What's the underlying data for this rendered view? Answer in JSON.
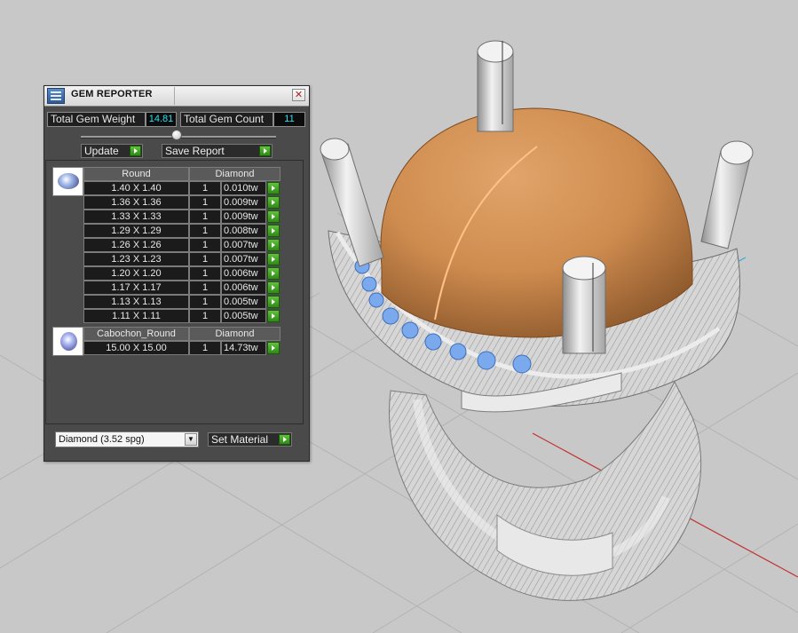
{
  "window": {
    "title": "GEM REPORTER",
    "close_glyph": "✕"
  },
  "stats": {
    "total_weight_label": "Total Gem Weight",
    "total_weight_value": "14.81",
    "total_count_label": "Total Gem Count",
    "total_count_value": "11"
  },
  "toolbar": {
    "update_label": "Update",
    "save_label": "Save Report"
  },
  "groups": [
    {
      "shape": "Round",
      "material": "Diamond",
      "rows": [
        {
          "size": "1.40 X 1.40",
          "count": "1",
          "weight": "0.010tw"
        },
        {
          "size": "1.36 X 1.36",
          "count": "1",
          "weight": "0.009tw"
        },
        {
          "size": "1.33 X 1.33",
          "count": "1",
          "weight": "0.009tw"
        },
        {
          "size": "1.29 X 1.29",
          "count": "1",
          "weight": "0.008tw"
        },
        {
          "size": "1.26 X 1.26",
          "count": "1",
          "weight": "0.007tw"
        },
        {
          "size": "1.23 X 1.23",
          "count": "1",
          "weight": "0.007tw"
        },
        {
          "size": "1.20 X 1.20",
          "count": "1",
          "weight": "0.006tw"
        },
        {
          "size": "1.17 X 1.17",
          "count": "1",
          "weight": "0.006tw"
        },
        {
          "size": "1.13 X 1.13",
          "count": "1",
          "weight": "0.005tw"
        },
        {
          "size": "1.11 X 1.11",
          "count": "1",
          "weight": "0.005tw"
        }
      ]
    },
    {
      "shape": "Cabochon_Round",
      "material": "Diamond",
      "rows": [
        {
          "size": "15.00 X 15.00",
          "count": "1",
          "weight": "14.73tw"
        }
      ]
    }
  ],
  "material_select": {
    "value": "Diamond     (3.52 spg)",
    "button_label": "Set Material"
  },
  "icons": {
    "app": "gem-reporter-app-icon",
    "close": "close-icon",
    "round_gem": "round-gem-thumbnail-icon",
    "cabochon_gem": "cabochon-gem-thumbnail-icon",
    "action": "green-arrow-icon",
    "dropdown": "chevron-down-icon"
  },
  "colors": {
    "panel_bg": "#4a4a4a",
    "value_text": "#29e1f0",
    "action_green": "#3fa61f",
    "gem_blue": "#7aa9ee",
    "cabochon_orange": "#d49152",
    "viewport_bg": "#c8c8c8"
  }
}
